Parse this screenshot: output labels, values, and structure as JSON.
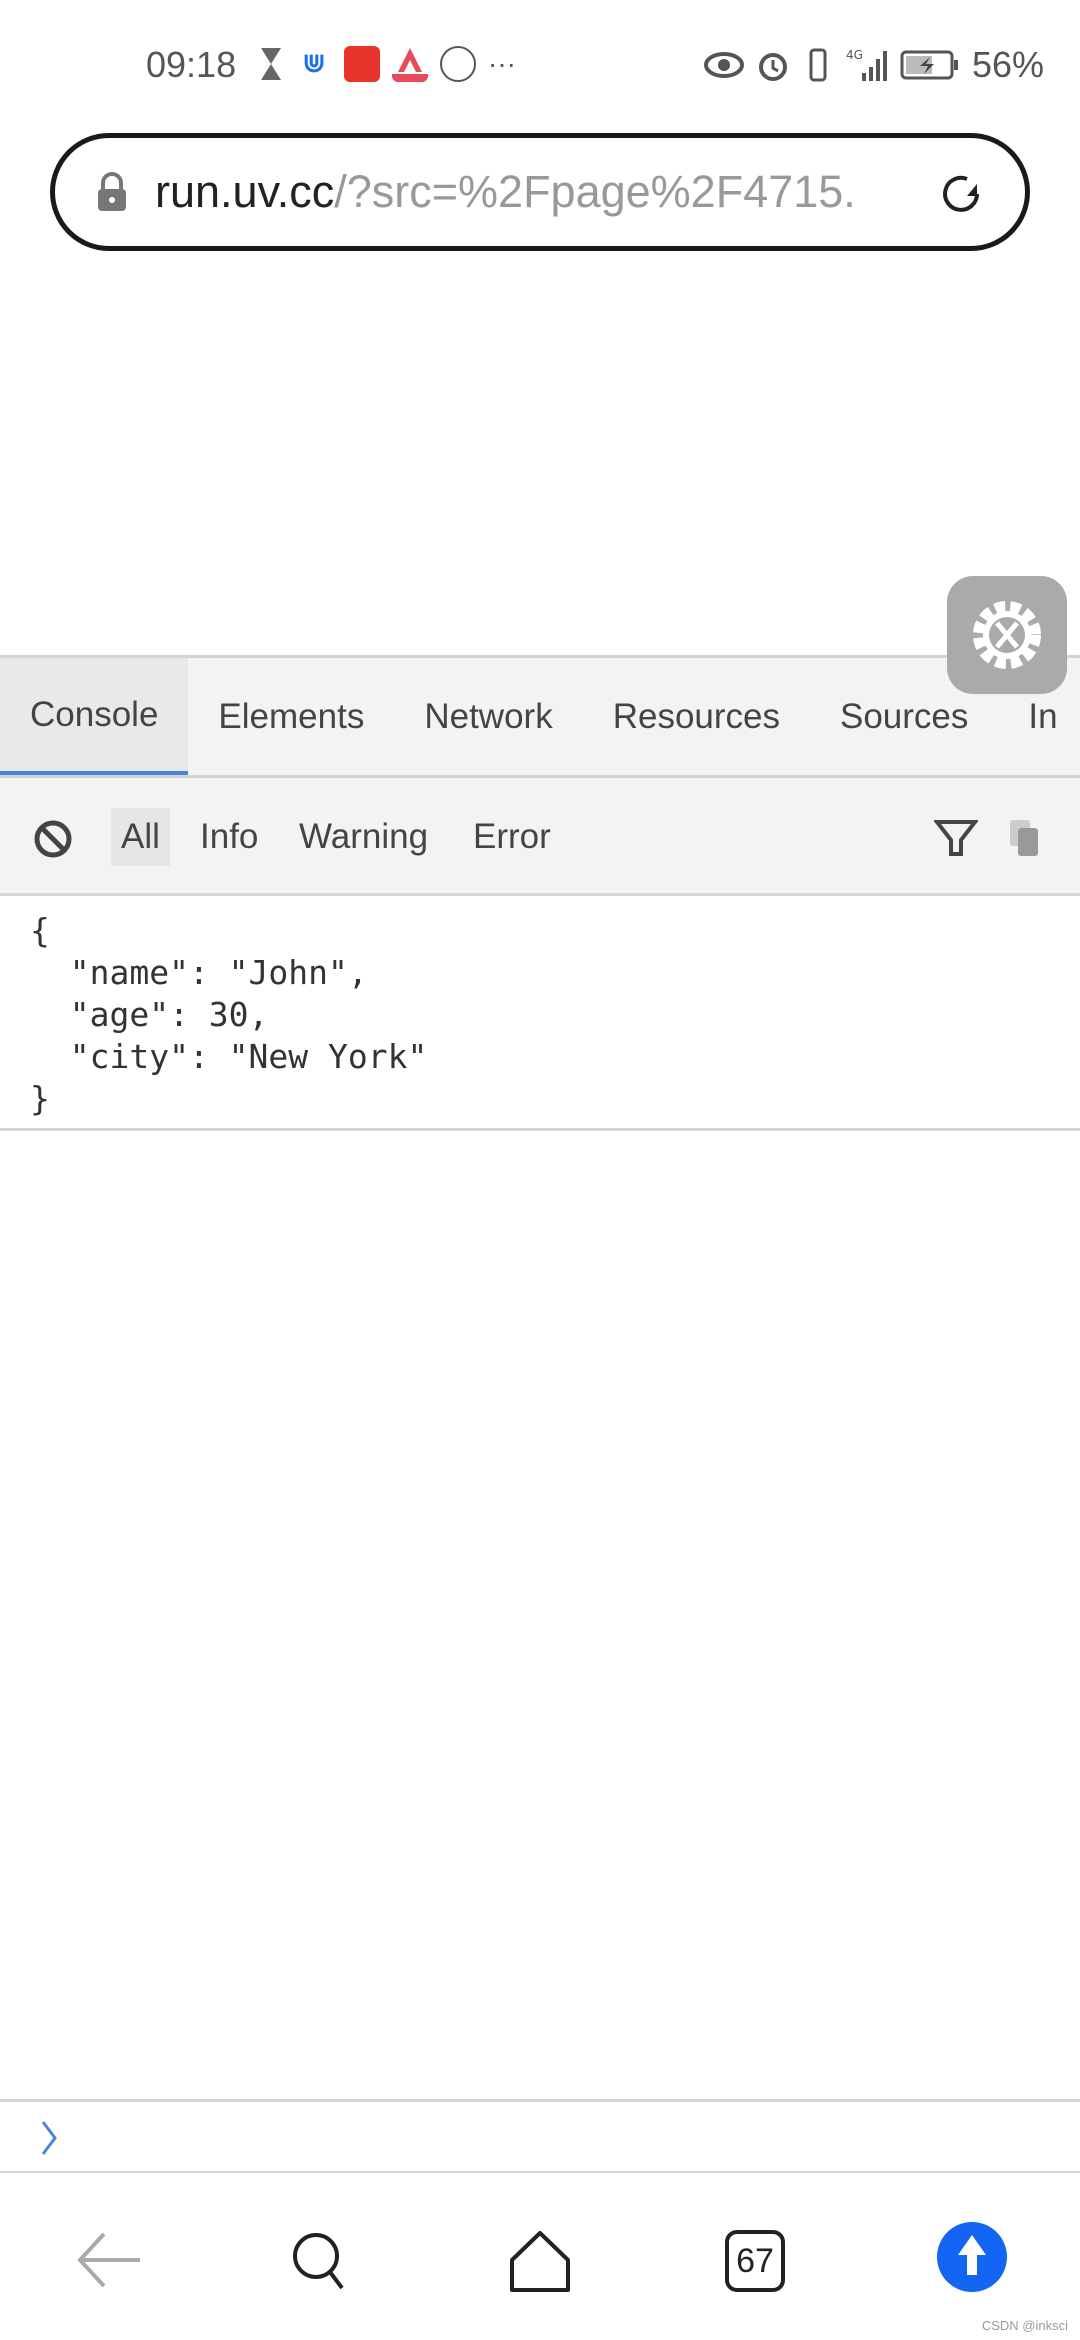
{
  "status_bar": {
    "time": "09:18",
    "battery": "56%",
    "network": "4G"
  },
  "address_bar": {
    "host": "run.uv.cc",
    "path": "/?src=%2Fpage%2F4715."
  },
  "devtools": {
    "tabs": [
      {
        "label": "Console"
      },
      {
        "label": "Elements"
      },
      {
        "label": "Network"
      },
      {
        "label": "Resources"
      },
      {
        "label": "Sources"
      },
      {
        "label": "In"
      }
    ],
    "active_tab": "Console",
    "filters": [
      {
        "label": "All"
      },
      {
        "label": "Info"
      },
      {
        "label": "Warning"
      },
      {
        "label": "Error"
      }
    ],
    "selected_filter": "All",
    "output_lines": [
      "{",
      "  \"name\": \"John\",",
      "  \"age\": 30,",
      "  \"city\": \"New York\"",
      "}"
    ],
    "accent_color": "#4a86d8"
  },
  "bottom_nav": {
    "tabs_count": "67",
    "upload_color": "#1565f5"
  },
  "watermark": "CSDN @inksci"
}
